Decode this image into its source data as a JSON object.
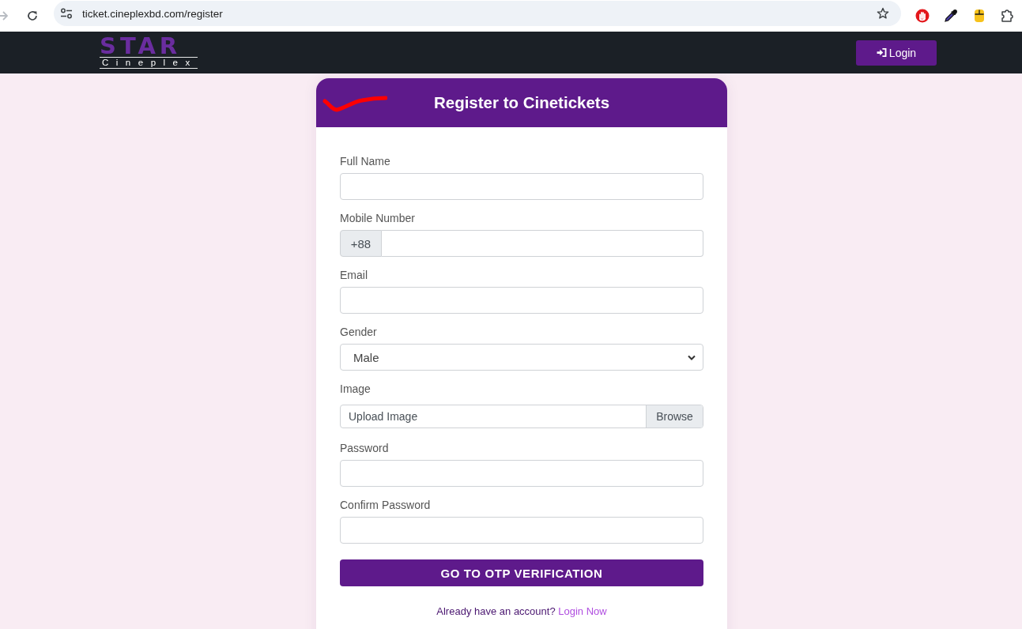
{
  "browser": {
    "url": "ticket.cineplexbd.com/register"
  },
  "navbar": {
    "logo": {
      "wordmark": "STAR",
      "subtitle": "Cineplex"
    },
    "login_button": "Login"
  },
  "form": {
    "title": "Register to Cinetickets",
    "fields": [
      {
        "kind": "text",
        "label": "Full Name"
      },
      {
        "kind": "phone",
        "label": "Mobile Number",
        "prefix": "+88"
      },
      {
        "kind": "text",
        "label": "Email"
      },
      {
        "kind": "select",
        "label": "Gender",
        "value": "Male"
      },
      {
        "kind": "file",
        "label": "Image",
        "file_label": "Upload Image",
        "button": "Browse"
      },
      {
        "kind": "password",
        "label": "Password"
      },
      {
        "kind": "password",
        "label": "Confirm Password"
      }
    ],
    "submit": "GO TO OTP VERIFICATION",
    "footer": {
      "text": "Already have an account?",
      "link": "Login Now"
    }
  }
}
